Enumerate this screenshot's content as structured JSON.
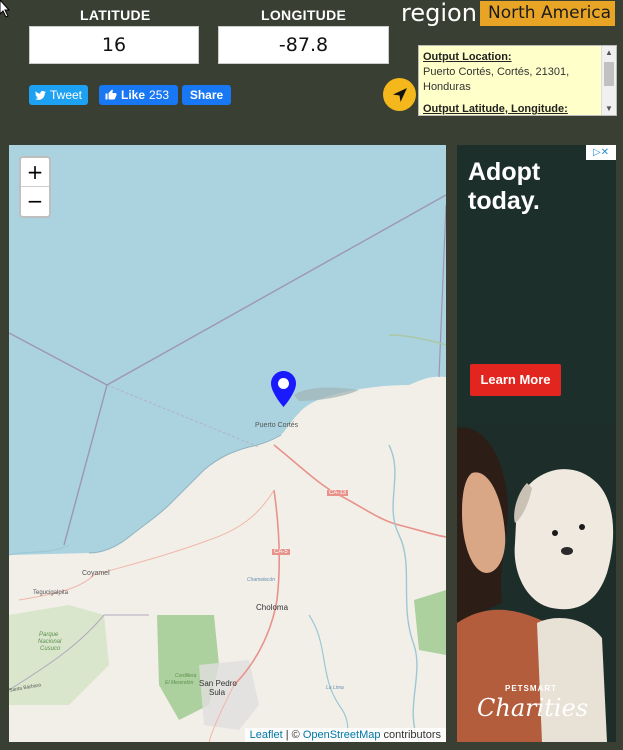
{
  "header": {
    "latitude_label": "LATITUDE",
    "longitude_label": "LONGITUDE",
    "latitude_value": "16",
    "longitude_value": "-87.8",
    "region_label": "region",
    "region_value": "North America"
  },
  "social": {
    "tweet_label": "Tweet",
    "like_label": "Like",
    "like_count": "253",
    "share_label": "Share"
  },
  "output": {
    "location_heading": "Output Location:",
    "location_text": "Puerto Cortés, Cortés, 21301, Honduras",
    "latlng_heading": "Output Latitude, Longitude:"
  },
  "map": {
    "zoom_in": "+",
    "zoom_out": "−",
    "attribution_leaflet": "Leaflet",
    "attribution_sep": " | © ",
    "attribution_osm": "OpenStreetMap",
    "attribution_tail": " contributors",
    "labels": {
      "puerto_cortes": "Puerto Cortés",
      "choloma": "Choloma",
      "san_pedro_1": "San Pedro",
      "san_pedro_2": "Sula",
      "ca13": "CA-13",
      "ca5": "CA-5",
      "coyamel": "Coyamel",
      "tegucigalpita": "Tegucigalpita",
      "cusuco_1": "Parque",
      "cusuco_2": "Nacional",
      "cusuco_3": "Cusuco",
      "merendon_1": "Cordillera",
      "merendon_2": "El Merendón",
      "santa_barbara": "Santa Bárbara",
      "chamelecon": "Chamelecón",
      "la_lima": "La Lima"
    },
    "colors": {
      "water": "#aad3df",
      "land": "#f2efe9",
      "forest": "#add19e",
      "marker": "#1a1aff"
    }
  },
  "ad": {
    "headline_1": "Adopt",
    "headline_2": "today.",
    "cta": "Learn More",
    "brand_top": "PETSMART",
    "brand": "Charities",
    "adchoice": "▷✕"
  }
}
